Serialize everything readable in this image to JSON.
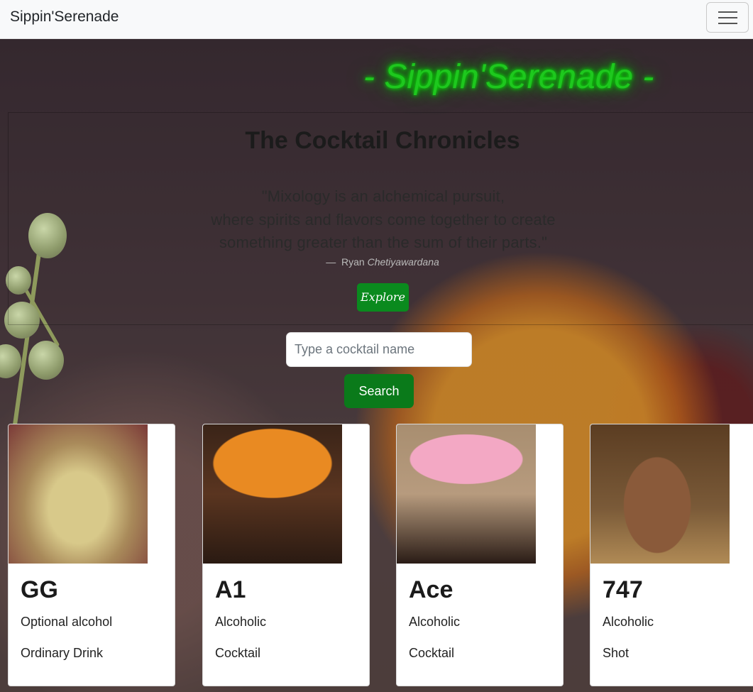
{
  "navbar": {
    "brand": "Sippin'Serenade",
    "toggle_icon": "menu-icon"
  },
  "hero": {
    "neon_title": "- Sippin'Serenade -",
    "title": "The Cocktail Chronicles",
    "quote_lines": [
      "\"Mixology is an alchemical pursuit,",
      "where spirits and flavors come together to create",
      "something greater than the sum of their parts.\""
    ],
    "cite_dash": "—",
    "cite_first": "Ryan",
    "cite_last": "Chetiyawardana",
    "explore_label": "Explore"
  },
  "search": {
    "placeholder": "Type a cocktail name",
    "button_label": "Search"
  },
  "cards": [
    {
      "name": "GG",
      "alcoholic": "Optional alcohol",
      "category": "Ordinary Drink"
    },
    {
      "name": "A1",
      "alcoholic": "Alcoholic",
      "category": "Cocktail"
    },
    {
      "name": "Ace",
      "alcoholic": "Alcoholic",
      "category": "Cocktail"
    },
    {
      "name": "747",
      "alcoholic": "Alcoholic",
      "category": "Shot"
    }
  ],
  "colors": {
    "neon": "#1ec81e",
    "button": "#0a7a1a",
    "explore": "#0a8a1e"
  }
}
